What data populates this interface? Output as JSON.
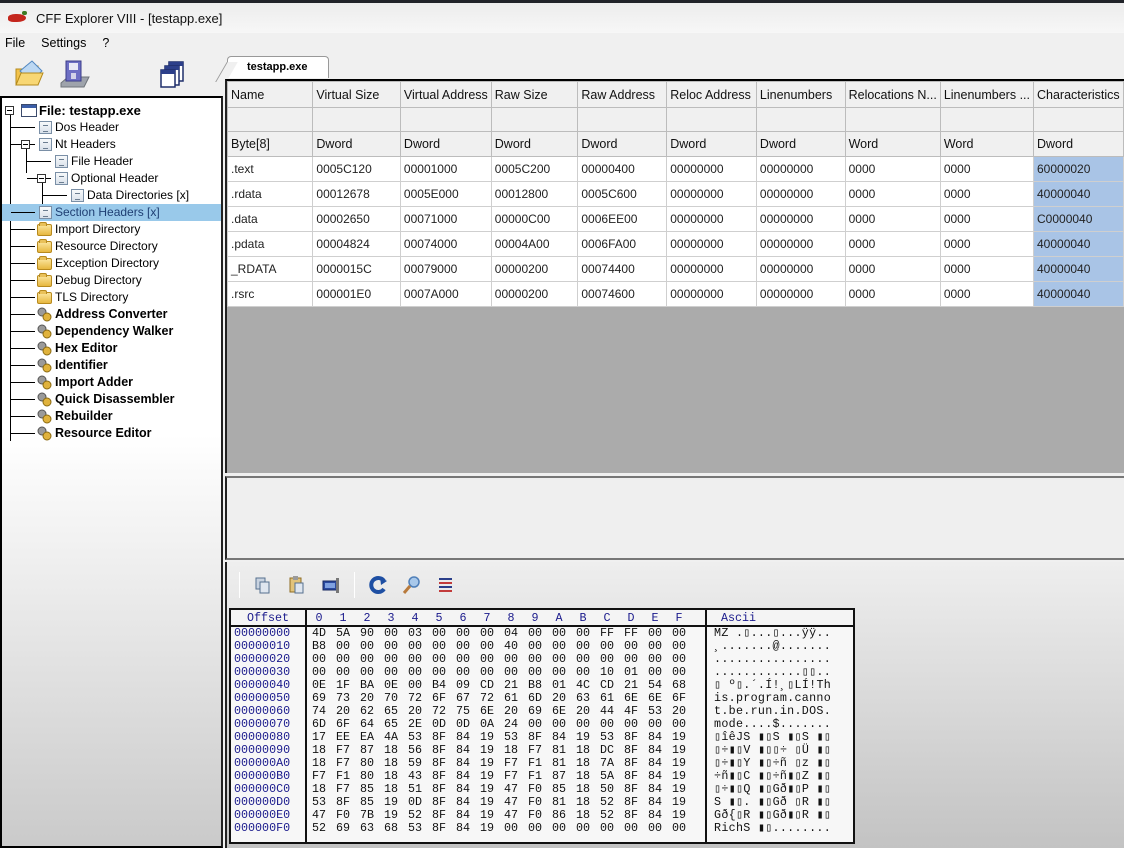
{
  "window": {
    "title": "CFF Explorer VIII - [testapp.exe]"
  },
  "menu": [
    "File",
    "Settings",
    "?"
  ],
  "toolbar": {
    "buttons": [
      "open-file-icon",
      "save-file-icon",
      "windows-icon"
    ]
  },
  "tree": {
    "root": "File: testapp.exe",
    "items": [
      {
        "label": "Dos Header",
        "icon": "doc-icon",
        "bold": false
      },
      {
        "label": "Nt Headers",
        "icon": "doc-icon",
        "bold": false
      },
      {
        "label": "File Header",
        "icon": "doc-icon",
        "bold": false
      },
      {
        "label": "Optional Header",
        "icon": "doc-icon",
        "bold": false
      },
      {
        "label": "Data Directories [x]",
        "icon": "doc-icon",
        "bold": false
      },
      {
        "label": "Section Headers [x]",
        "icon": "doc-icon",
        "bold": false,
        "selected": true
      },
      {
        "label": "Import Directory",
        "icon": "folder-icon",
        "bold": false
      },
      {
        "label": "Resource Directory",
        "icon": "folder-icon",
        "bold": false
      },
      {
        "label": "Exception Directory",
        "icon": "folder-icon",
        "bold": false
      },
      {
        "label": "Debug Directory",
        "icon": "folder-icon",
        "bold": false
      },
      {
        "label": "TLS Directory",
        "icon": "folder-icon",
        "bold": false
      },
      {
        "label": "Address Converter",
        "icon": "tool-icon",
        "bold": true
      },
      {
        "label": "Dependency Walker",
        "icon": "tool-icon",
        "bold": true
      },
      {
        "label": "Hex Editor",
        "icon": "tool-icon",
        "bold": true
      },
      {
        "label": "Identifier",
        "icon": "tool-icon",
        "bold": true
      },
      {
        "label": "Import Adder",
        "icon": "tool-icon",
        "bold": true
      },
      {
        "label": "Quick Disassembler",
        "icon": "tool-icon",
        "bold": true
      },
      {
        "label": "Rebuilder",
        "icon": "tool-icon",
        "bold": true
      },
      {
        "label": "Resource Editor",
        "icon": "tool-icon",
        "bold": true
      }
    ]
  },
  "tab": {
    "label": "testapp.exe"
  },
  "sections_table": {
    "columns": [
      "Name",
      "Virtual Size",
      "Virtual Address",
      "Raw Size",
      "Raw Address",
      "Reloc Address",
      "Linenumbers",
      "Relocations N...",
      "Linenumbers ...",
      "Characteristics"
    ],
    "types": [
      "Byte[8]",
      "Dword",
      "Dword",
      "Dword",
      "Dword",
      "Dword",
      "Dword",
      "Word",
      "Word",
      "Dword"
    ],
    "rows": [
      [
        ".text",
        "0005C120",
        "00001000",
        "0005C200",
        "00000400",
        "00000000",
        "00000000",
        "0000",
        "0000",
        "60000020"
      ],
      [
        ".rdata",
        "00012678",
        "0005E000",
        "00012800",
        "0005C600",
        "00000000",
        "00000000",
        "0000",
        "0000",
        "40000040"
      ],
      [
        ".data",
        "00002650",
        "00071000",
        "00000C00",
        "0006EE00",
        "00000000",
        "00000000",
        "0000",
        "0000",
        "C0000040"
      ],
      [
        ".pdata",
        "00004824",
        "00074000",
        "00004A00",
        "0006FA00",
        "00000000",
        "00000000",
        "0000",
        "0000",
        "40000040"
      ],
      [
        "_RDATA",
        "0000015C",
        "00079000",
        "00000200",
        "00074400",
        "00000000",
        "00000000",
        "0000",
        "0000",
        "40000040"
      ],
      [
        ".rsrc",
        "000001E0",
        "0007A000",
        "00000200",
        "00074600",
        "00000000",
        "00000000",
        "0000",
        "0000",
        "40000040"
      ]
    ]
  },
  "hex_toolbar": {
    "buttons": [
      "copy-icon",
      "paste-icon",
      "resize-icon",
      "goto-icon",
      "search-icon",
      "select-range-icon"
    ]
  },
  "hexview": {
    "offset_header": "Offset",
    "byte_headers": [
      "0",
      "1",
      "2",
      "3",
      "4",
      "5",
      "6",
      "7",
      "8",
      "9",
      "A",
      "B",
      "C",
      "D",
      "E",
      "F"
    ],
    "ascii_header": "Ascii",
    "rows": [
      {
        "offset": "00000000",
        "bytes": [
          "4D",
          "5A",
          "90",
          "00",
          "03",
          "00",
          "00",
          "00",
          "04",
          "00",
          "00",
          "00",
          "FF",
          "FF",
          "00",
          "00"
        ],
        "ascii": "MZ .▯...▯...ÿÿ.."
      },
      {
        "offset": "00000010",
        "bytes": [
          "B8",
          "00",
          "00",
          "00",
          "00",
          "00",
          "00",
          "00",
          "40",
          "00",
          "00",
          "00",
          "00",
          "00",
          "00",
          "00"
        ],
        "ascii": "¸.......@......."
      },
      {
        "offset": "00000020",
        "bytes": [
          "00",
          "00",
          "00",
          "00",
          "00",
          "00",
          "00",
          "00",
          "00",
          "00",
          "00",
          "00",
          "00",
          "00",
          "00",
          "00"
        ],
        "ascii": "................"
      },
      {
        "offset": "00000030",
        "bytes": [
          "00",
          "00",
          "00",
          "00",
          "00",
          "00",
          "00",
          "00",
          "00",
          "00",
          "00",
          "00",
          "10",
          "01",
          "00",
          "00"
        ],
        "ascii": "............▯▯.."
      },
      {
        "offset": "00000040",
        "bytes": [
          "0E",
          "1F",
          "BA",
          "0E",
          "00",
          "B4",
          "09",
          "CD",
          "21",
          "B8",
          "01",
          "4C",
          "CD",
          "21",
          "54",
          "68"
        ],
        "ascii": "▯ º▯.´.Í!¸▯LÍ!Th"
      },
      {
        "offset": "00000050",
        "bytes": [
          "69",
          "73",
          "20",
          "70",
          "72",
          "6F",
          "67",
          "72",
          "61",
          "6D",
          "20",
          "63",
          "61",
          "6E",
          "6E",
          "6F"
        ],
        "ascii": "is.program.canno"
      },
      {
        "offset": "00000060",
        "bytes": [
          "74",
          "20",
          "62",
          "65",
          "20",
          "72",
          "75",
          "6E",
          "20",
          "69",
          "6E",
          "20",
          "44",
          "4F",
          "53",
          "20"
        ],
        "ascii": "t.be.run.in.DOS."
      },
      {
        "offset": "00000070",
        "bytes": [
          "6D",
          "6F",
          "64",
          "65",
          "2E",
          "0D",
          "0D",
          "0A",
          "24",
          "00",
          "00",
          "00",
          "00",
          "00",
          "00",
          "00"
        ],
        "ascii": "mode....$......."
      },
      {
        "offset": "00000080",
        "bytes": [
          "17",
          "EE",
          "EA",
          "4A",
          "53",
          "8F",
          "84",
          "19",
          "53",
          "8F",
          "84",
          "19",
          "53",
          "8F",
          "84",
          "19"
        ],
        "ascii": "▯îêJS ▮▯S ▮▯S ▮▯"
      },
      {
        "offset": "00000090",
        "bytes": [
          "18",
          "F7",
          "87",
          "18",
          "56",
          "8F",
          "84",
          "19",
          "18",
          "F7",
          "81",
          "18",
          "DC",
          "8F",
          "84",
          "19"
        ],
        "ascii": "▯÷▮▯V ▮▯▯÷ ▯Ü ▮▯"
      },
      {
        "offset": "000000A0",
        "bytes": [
          "18",
          "F7",
          "80",
          "18",
          "59",
          "8F",
          "84",
          "19",
          "F7",
          "F1",
          "81",
          "18",
          "7A",
          "8F",
          "84",
          "19"
        ],
        "ascii": "▯÷▮▯Y ▮▯÷ñ ▯z ▮▯"
      },
      {
        "offset": "000000B0",
        "bytes": [
          "F7",
          "F1",
          "80",
          "18",
          "43",
          "8F",
          "84",
          "19",
          "F7",
          "F1",
          "87",
          "18",
          "5A",
          "8F",
          "84",
          "19"
        ],
        "ascii": "÷ñ▮▯C ▮▯÷ñ▮▯Z ▮▯"
      },
      {
        "offset": "000000C0",
        "bytes": [
          "18",
          "F7",
          "85",
          "18",
          "51",
          "8F",
          "84",
          "19",
          "47",
          "F0",
          "85",
          "18",
          "50",
          "8F",
          "84",
          "19"
        ],
        "ascii": "▯÷▮▯Q ▮▯Gð▮▯P ▮▯"
      },
      {
        "offset": "000000D0",
        "bytes": [
          "53",
          "8F",
          "85",
          "19",
          "0D",
          "8F",
          "84",
          "19",
          "47",
          "F0",
          "81",
          "18",
          "52",
          "8F",
          "84",
          "19"
        ],
        "ascii": "S ▮▯. ▮▯Gð ▯R ▮▯"
      },
      {
        "offset": "000000E0",
        "bytes": [
          "47",
          "F0",
          "7B",
          "19",
          "52",
          "8F",
          "84",
          "19",
          "47",
          "F0",
          "86",
          "18",
          "52",
          "8F",
          "84",
          "19"
        ],
        "ascii": "Gð{▯R ▮▯Gð▮▯R ▮▯"
      },
      {
        "offset": "000000F0",
        "bytes": [
          "52",
          "69",
          "63",
          "68",
          "53",
          "8F",
          "84",
          "19",
          "00",
          "00",
          "00",
          "00",
          "00",
          "00",
          "00",
          "00"
        ],
        "ascii": "RichS ▮▯........"
      }
    ]
  }
}
